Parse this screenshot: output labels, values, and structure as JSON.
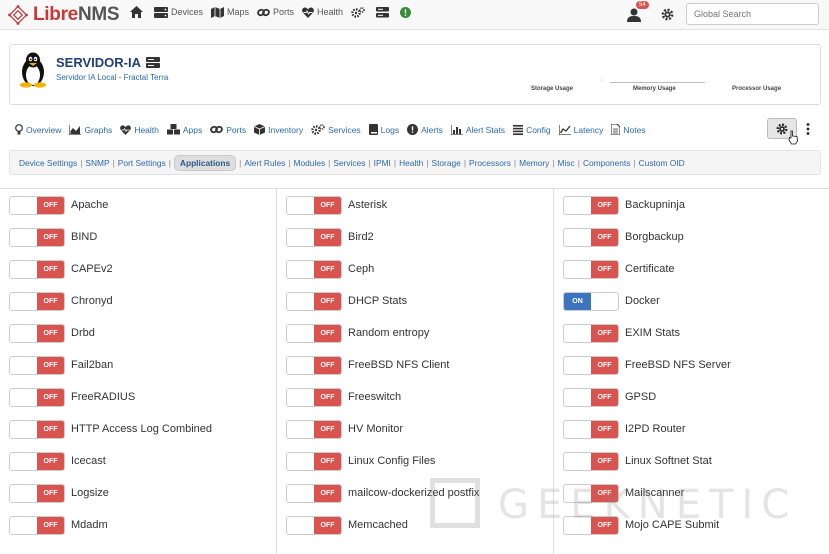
{
  "navbar": {
    "logo": {
      "brand_part1": "Libre",
      "brand_part2": "NMS",
      "icon": "librenms-logo-icon"
    },
    "items": [
      {
        "label": "",
        "icon": "home-icon"
      },
      {
        "label": "Devices",
        "icon": "server-icon"
      },
      {
        "label": "Maps",
        "icon": "map-icon"
      },
      {
        "label": "Ports",
        "icon": "link-icon"
      },
      {
        "label": "Health",
        "icon": "heartbeat-icon"
      },
      {
        "label": "",
        "icon": "cogs-icon"
      },
      {
        "label": "",
        "icon": "database-icon"
      },
      {
        "label": "",
        "icon": "exclamation-circle-icon"
      }
    ],
    "notifications_count": "54",
    "search_placeholder": "Global Search"
  },
  "device": {
    "name": "SERVIDOR-IA",
    "subtitle": "Servidor IA Local - Fractal Terra",
    "usage_labels": {
      "storage": "Storage Usage",
      "memory": "Memory Usage",
      "processor": "Processor Usage"
    }
  },
  "tabs": [
    {
      "label": "Overview",
      "icon": "lightbulb-icon"
    },
    {
      "label": "Graphs",
      "icon": "area-chart-icon"
    },
    {
      "label": "Health",
      "icon": "heartbeat-icon"
    },
    {
      "label": "Apps",
      "icon": "cubes-icon"
    },
    {
      "label": "Ports",
      "icon": "link-icon"
    },
    {
      "label": "Inventory",
      "icon": "cube-icon"
    },
    {
      "label": "Services",
      "icon": "cogs-icon"
    },
    {
      "label": "Logs",
      "icon": "book-icon"
    },
    {
      "label": "Alerts",
      "icon": "exclamation-circle-icon"
    },
    {
      "label": "Alert Stats",
      "icon": "bar-chart-icon"
    },
    {
      "label": "Config",
      "icon": "align-justify-icon"
    },
    {
      "label": "Latency",
      "icon": "line-chart-icon"
    },
    {
      "label": "Notes",
      "icon": "file-text-icon"
    }
  ],
  "settings_nav": {
    "items": [
      "Device Settings",
      "SNMP",
      "Port Settings",
      "Applications",
      "Alert Rules",
      "Modules",
      "Services",
      "IPMI",
      "Health",
      "Storage",
      "Processors",
      "Memory",
      "Misc",
      "Components",
      "Custom OID"
    ],
    "active": "Applications"
  },
  "applications": {
    "col1": [
      {
        "name": "Apache",
        "state": "OFF"
      },
      {
        "name": "BIND",
        "state": "OFF"
      },
      {
        "name": "CAPEv2",
        "state": "OFF"
      },
      {
        "name": "Chronyd",
        "state": "OFF"
      },
      {
        "name": "Drbd",
        "state": "OFF"
      },
      {
        "name": "Fail2ban",
        "state": "OFF"
      },
      {
        "name": "FreeRADIUS",
        "state": "OFF"
      },
      {
        "name": "HTTP Access Log Combined",
        "state": "OFF"
      },
      {
        "name": "Icecast",
        "state": "OFF"
      },
      {
        "name": "Logsize",
        "state": "OFF"
      },
      {
        "name": "Mdadm",
        "state": "OFF"
      }
    ],
    "col2": [
      {
        "name": "Asterisk",
        "state": "OFF"
      },
      {
        "name": "Bird2",
        "state": "OFF"
      },
      {
        "name": "Ceph",
        "state": "OFF"
      },
      {
        "name": "DHCP Stats",
        "state": "OFF"
      },
      {
        "name": "Random entropy",
        "state": "OFF"
      },
      {
        "name": "FreeBSD NFS Client",
        "state": "OFF"
      },
      {
        "name": "Freeswitch",
        "state": "OFF"
      },
      {
        "name": "HV Monitor",
        "state": "OFF"
      },
      {
        "name": "Linux Config Files",
        "state": "OFF"
      },
      {
        "name": "mailcow-dockerized postfix",
        "state": "OFF"
      },
      {
        "name": "Memcached",
        "state": "OFF"
      }
    ],
    "col3": [
      {
        "name": "Backupninja",
        "state": "OFF"
      },
      {
        "name": "Borgbackup",
        "state": "OFF"
      },
      {
        "name": "Certificate",
        "state": "OFF"
      },
      {
        "name": "Docker",
        "state": "ON"
      },
      {
        "name": "EXIM Stats",
        "state": "OFF"
      },
      {
        "name": "FreeBSD NFS Server",
        "state": "OFF"
      },
      {
        "name": "GPSD",
        "state": "OFF"
      },
      {
        "name": "I2PD Router",
        "state": "OFF"
      },
      {
        "name": "Linux Softnet Stat",
        "state": "OFF"
      },
      {
        "name": "Mailscanner",
        "state": "OFF"
      },
      {
        "name": "Mojo CAPE Submit",
        "state": "OFF"
      }
    ]
  },
  "watermark": {
    "text": "GEEKNETIC"
  },
  "colors": {
    "off": "#d9534f",
    "on": "#3c75bd",
    "link": "#2c6aa8",
    "brand": "#c73838"
  }
}
